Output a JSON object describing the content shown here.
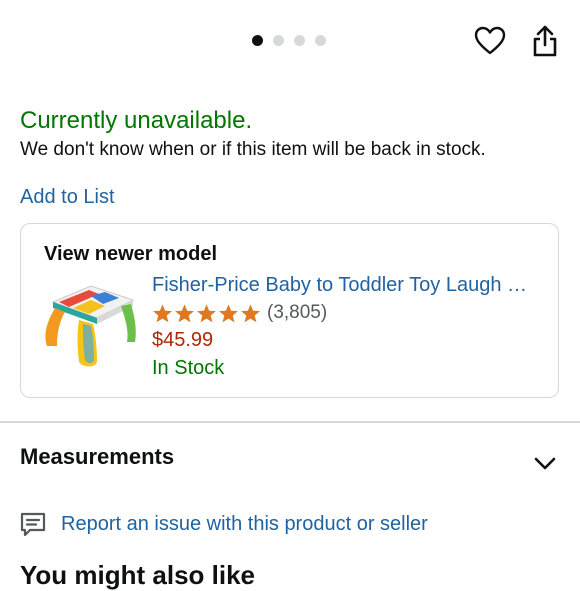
{
  "carousel": {
    "total": 4,
    "active": 0
  },
  "availability": {
    "status": "Currently unavailable.",
    "note": "We don't know when or if this item will be back in stock."
  },
  "add_to_list": "Add to List",
  "newer_model": {
    "heading": "View newer model",
    "title": "Fisher-Price Baby to Toddler Toy Laugh …",
    "rating_count": "(3,805)",
    "rating": 5,
    "price": "$45.99",
    "stock": "In Stock"
  },
  "measurements": {
    "label": "Measurements"
  },
  "report": {
    "label": "Report an issue with this product or seller"
  },
  "recommendations": {
    "heading": "You might also like"
  },
  "colors": {
    "accent_green": "#007600",
    "link_blue": "#2162a1",
    "price_red": "#b12704",
    "star_orange": "#de7921"
  },
  "icons": [
    "heart-icon",
    "share-icon",
    "star-icon",
    "chevron-down-icon",
    "report-icon"
  ]
}
